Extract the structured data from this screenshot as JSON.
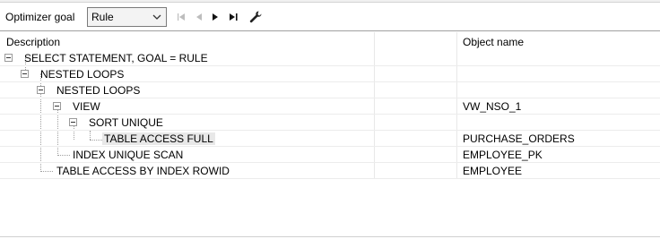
{
  "toolbar": {
    "optimizer_label": "Optimizer goal",
    "goal_value": "Rule",
    "icons": [
      "first-icon",
      "prev-icon",
      "next-icon",
      "last-icon",
      "wrench-icon"
    ]
  },
  "columns": {
    "description": "Description",
    "object_name": "Object name"
  },
  "rows": [
    {
      "description": "SELECT STATEMENT, GOAL = RULE",
      "object": ""
    },
    {
      "description": "NESTED LOOPS",
      "object": ""
    },
    {
      "description": "NESTED LOOPS",
      "object": ""
    },
    {
      "description": "VIEW",
      "object": "VW_NSO_1"
    },
    {
      "description": "SORT UNIQUE",
      "object": ""
    },
    {
      "description": "TABLE ACCESS FULL",
      "object": "PURCHASE_ORDERS"
    },
    {
      "description": "INDEX UNIQUE SCAN",
      "object": "EMPLOYEE_PK"
    },
    {
      "description": "TABLE ACCESS BY INDEX ROWID",
      "object": "EMPLOYEE"
    }
  ],
  "colors": {
    "selection": "#e8e8e8",
    "border": "#a0a0a0"
  }
}
